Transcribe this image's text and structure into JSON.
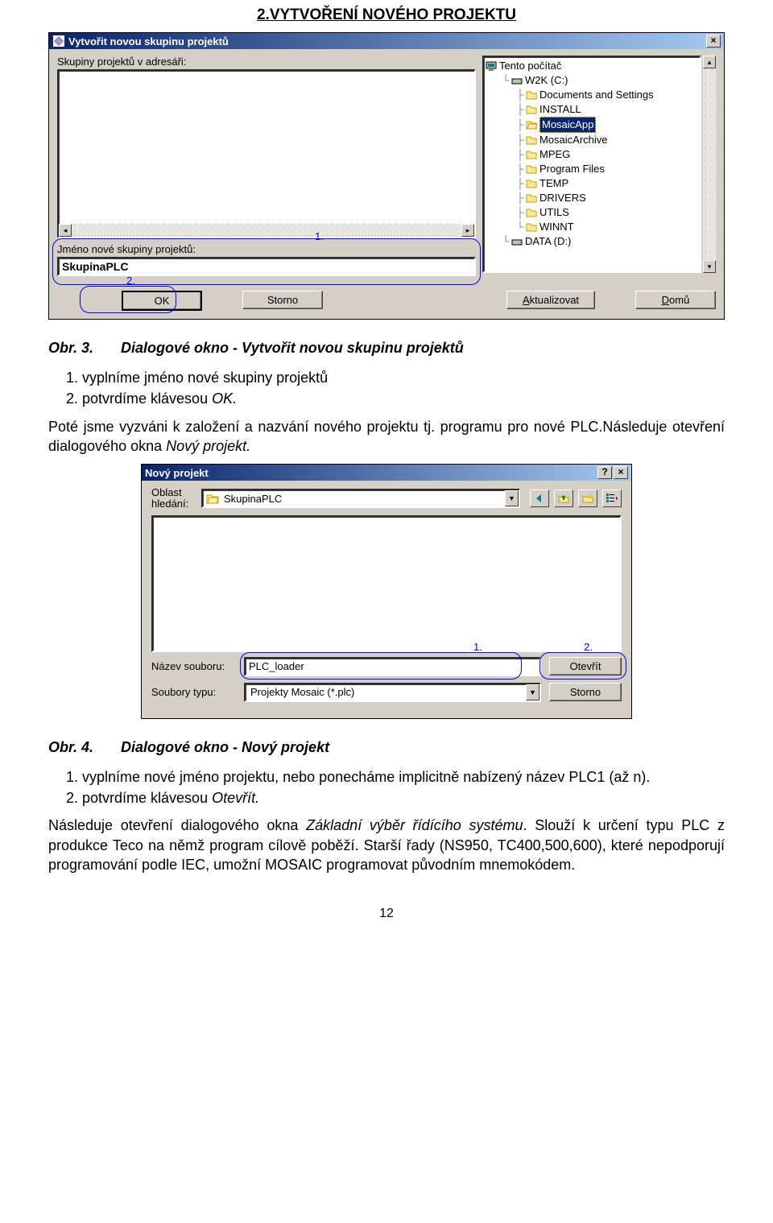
{
  "section_heading": "2.VYTVOŘENÍ NOVÉHO PROJEKTU",
  "dlg1": {
    "title": "Vytvořit novou skupinu projektů",
    "left_label": "Skupiny projektů v adresáři:",
    "group_name_label": "Jméno nové skupiny projektů:",
    "group_name_value": "SkupinaPLC",
    "btn_ok": "OK",
    "btn_cancel": "Storno",
    "btn_refresh": "Aktualizovat",
    "btn_home": "Domů",
    "btn_home_mnemonic": "D",
    "tree": {
      "root": "Tento počítač",
      "drive_c": "W2K (C:)",
      "items": [
        "Documents and Settings",
        "INSTALL",
        "MosaicApp",
        "MosaicArchive",
        "MPEG",
        "Program Files",
        "TEMP",
        "DRIVERS",
        "UTILS",
        "WINNT"
      ],
      "selected": "MosaicApp",
      "drive_d": "DATA (D:)"
    },
    "annot1": "1.",
    "annot2": "2."
  },
  "caption3": {
    "label": "Obr. 3.",
    "text": "Dialogové okno - Vytvořit novou skupinu projektů"
  },
  "step3_1": "vyplníme jméno nové skupiny projektů",
  "step3_2_a": "potvrdíme klávesou ",
  "step3_2_b": "OK.",
  "para1_a": "Poté jsme vyzváni k založení a nazvání nového projektu tj. programu pro nové PLC.Následuje otevření dialogového okna ",
  "para1_b": "Nový projekt.",
  "dlg2": {
    "title": "Nový projekt",
    "lookin_label": "Oblast hledání:",
    "lookin_value": "SkupinaPLC",
    "name_label": "Název souboru:",
    "name_value": "PLC_loader",
    "type_label": "Soubory typu:",
    "type_value": "Projekty Mosaic (*.plc)",
    "btn_open": "Otevřít",
    "btn_cancel": "Storno",
    "annot1": "1.",
    "annot2": "2."
  },
  "caption4": {
    "label": "Obr. 4.",
    "text": "Dialogové okno - Nový projekt"
  },
  "step4_1": "vyplníme nové jméno projektu, nebo ponecháme implicitně nabízený název PLC1 (až n).",
  "step4_2_a": "potvrdíme klávesou ",
  "step4_2_b": "Otevřít.",
  "para2_a": "Následuje otevření dialogového okna ",
  "para2_b": "Základní výběr řídícího systému",
  "para2_c": ". Slouží k určení typu PLC z produkce Teco na němž program cílově poběží. Starší řady (NS950, TC400,500,600), které nepodporují programování podle IEC, umožní MOSAIC programovat původním mnemokódem.",
  "page_number": "12"
}
